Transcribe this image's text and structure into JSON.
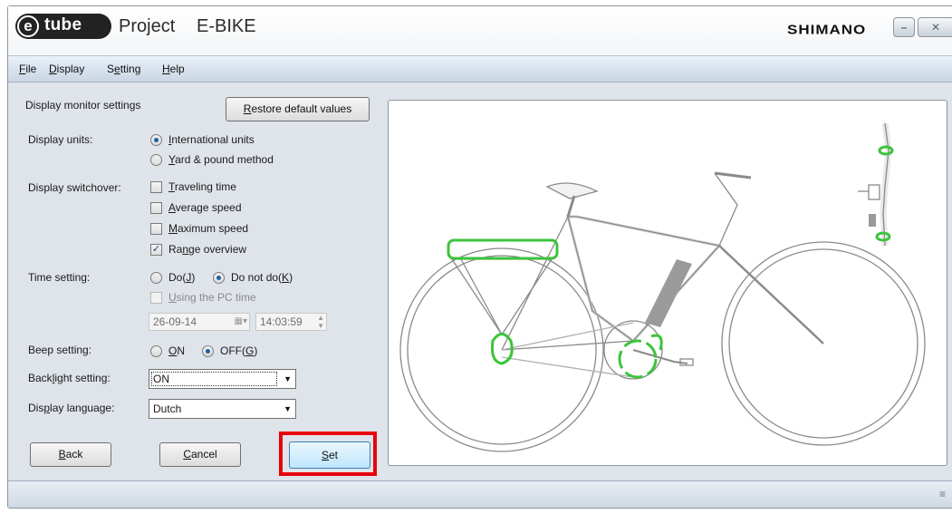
{
  "titlebar": {
    "logo_letter": "e",
    "logo_text": "tube",
    "title": "Project",
    "subtitle": "E-BIKE",
    "brand": "SHIMANO",
    "minimize_symbol": "–",
    "close_symbol": "✕"
  },
  "menu": {
    "file": "F",
    "file_rest": "ile",
    "display": "D",
    "display_rest": "isplay",
    "setting_pre": "S",
    "setting_key": "e",
    "setting_rest": "tting",
    "help": "H",
    "help_rest": "elp"
  },
  "panel": {
    "heading": "Display monitor settings",
    "restore_key": "R",
    "restore_rest": "estore default values",
    "display_units_label": "Display units:",
    "units": {
      "intl_key": "I",
      "intl_rest": "nternational units",
      "intl_selected": true,
      "yard_key": "Y",
      "yard_rest": "ard & pound method",
      "yard_selected": false
    },
    "switchover_label": "Display switchover:",
    "switchover": [
      {
        "key": "T",
        "rest": "raveling time",
        "checked": false
      },
      {
        "key": "A",
        "rest": "verage speed",
        "checked": false
      },
      {
        "key": "M",
        "rest": "aximum speed",
        "checked": false
      },
      {
        "pre": "Ra",
        "key": "n",
        "rest": "ge overview",
        "checked": true
      }
    ],
    "time_label": "Time setting:",
    "time_do": "Do(",
    "time_do_key": "J",
    "time_do_end": ")",
    "time_donot": "Do not do(",
    "time_donot_key": "K",
    "time_donot_end": ")",
    "time_do_selected": false,
    "pc_time_key": "U",
    "pc_time_rest": "sing the PC time",
    "pc_time_checked": false,
    "date_value": "26-09-14",
    "time_value": "14:03:59",
    "beep_label": "Beep setting:",
    "beep_on_key": "O",
    "beep_on_rest": "N",
    "beep_off": "OFF(",
    "beep_off_key": "G",
    "beep_off_end": ")",
    "beep_off_selected": true,
    "backlight_label_pre": "Back",
    "backlight_label_key": "l",
    "backlight_label_rest": "ight setting:",
    "backlight_value": "ON",
    "language_label_pre": "Dis",
    "language_label_key": "p",
    "language_label_rest": "lay language:",
    "language_value": "Dutch",
    "back_key": "B",
    "back_rest": "ack",
    "cancel_key": "C",
    "cancel_rest": "ancel",
    "set_key": "S",
    "set_rest": "et"
  },
  "colors": {
    "highlight": "#e8000b",
    "component_green": "#3cc43c",
    "battery_gray": "#9a9a9a"
  }
}
